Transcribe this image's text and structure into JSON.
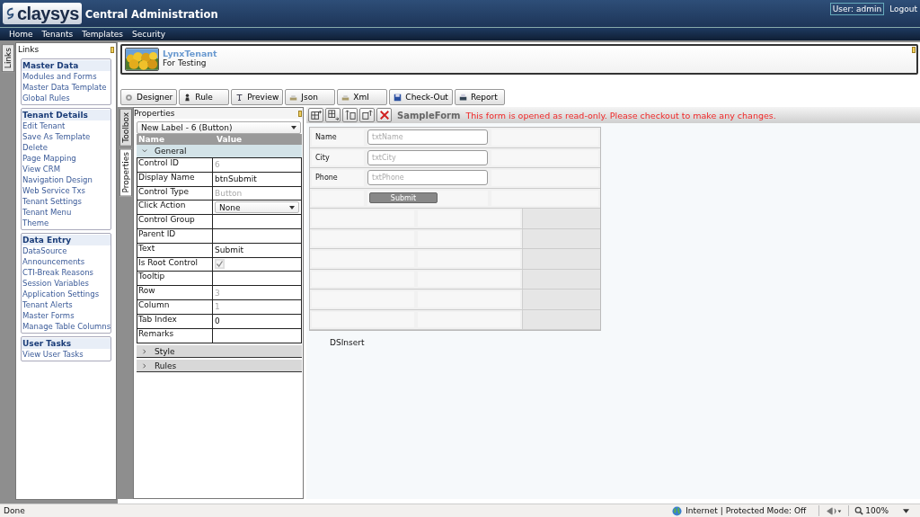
{
  "header": {
    "logo": "claysys",
    "title": "Central Administration",
    "user": "User: admin",
    "logout": "Logout"
  },
  "menu": [
    "Home",
    "Tenants",
    "Templates",
    "Security"
  ],
  "side_tabs": [
    "Links"
  ],
  "links": {
    "title": "Links",
    "groups": [
      {
        "title": "Master Data",
        "items": [
          "Modules and Forms",
          "Master Data Template",
          "Global Rules"
        ]
      },
      {
        "title": "Tenant Details",
        "items": [
          "Edit Tenant",
          "Save As Template",
          "Delete",
          "Page Mapping",
          "View CRM",
          "Navigation Design",
          "Web Service Txs",
          "Tenant Settings",
          "Tenant Menu",
          "Theme"
        ]
      },
      {
        "title": "Data Entry",
        "items": [
          "DataSource",
          "Announcements",
          "CTI-Break Reasons",
          "Session Variables",
          "Application Settings",
          "Tenant Alerts",
          "Master Forms",
          "Manage Table Columns"
        ]
      },
      {
        "title": "User Tasks",
        "items": [
          "View User Tasks"
        ]
      }
    ]
  },
  "tenant": {
    "name": "LynxTenant",
    "description": "For Testing"
  },
  "toolbar": [
    {
      "label": "Designer"
    },
    {
      "label": "Rule"
    },
    {
      "label": "Preview"
    },
    {
      "label": "Json"
    },
    {
      "label": "Xml"
    },
    {
      "label": "Check-Out"
    },
    {
      "label": "Report"
    }
  ],
  "panel_tabs": [
    {
      "label": "Toolbox",
      "selected": false
    },
    {
      "label": "Properties",
      "selected": true
    }
  ],
  "properties": {
    "title": "Properties",
    "selector": "New Label - 6 (Button)",
    "columns": [
      "Name",
      "Value"
    ],
    "sections": [
      {
        "title": "General",
        "expanded": true,
        "rows": [
          {
            "name": "Control ID",
            "kind": "text",
            "value": "6",
            "disabled": true
          },
          {
            "name": "Display Name",
            "kind": "text",
            "value": "btnSubmit",
            "disabled": false
          },
          {
            "name": "Control Type",
            "kind": "text",
            "value": "Button",
            "disabled": true
          },
          {
            "name": "Click Action",
            "kind": "dropdown",
            "value": "None",
            "disabled": false
          },
          {
            "name": "Control Group",
            "kind": "text"
          },
          {
            "name": "Parent ID",
            "kind": "text"
          },
          {
            "name": "Text",
            "kind": "text",
            "value": "Submit",
            "disabled": false
          },
          {
            "name": "Is Root Control",
            "kind": "checkbox",
            "checked": true,
            "disabled": true
          },
          {
            "name": "Tooltip",
            "kind": "text"
          },
          {
            "name": "Row",
            "kind": "text",
            "value": "3",
            "disabled": true
          },
          {
            "name": "Column",
            "kind": "text",
            "value": "1",
            "disabled": true
          },
          {
            "name": "Tab Index",
            "kind": "text",
            "value": "0",
            "disabled": false
          },
          {
            "name": "Remarks",
            "kind": "text"
          }
        ]
      },
      {
        "title": "Style",
        "expanded": false
      },
      {
        "title": "Rules",
        "expanded": false
      }
    ]
  },
  "form_toolbar": {
    "form_name": "SampleForm",
    "message": "This form is opened as read-only. Please checkout to make any changes."
  },
  "form": {
    "rows": [
      {
        "kind": "field",
        "label": "Name",
        "placeholder": "txtName"
      },
      {
        "kind": "field",
        "label": "City",
        "placeholder": "txtCity"
      },
      {
        "kind": "field",
        "label": "Phone",
        "placeholder": "txtPhone"
      },
      {
        "kind": "button",
        "button": "Submit"
      },
      {
        "kind": "empty"
      },
      {
        "kind": "empty"
      },
      {
        "kind": "empty"
      },
      {
        "kind": "empty"
      },
      {
        "kind": "empty"
      },
      {
        "kind": "empty"
      }
    ],
    "footer": "DSInsert"
  },
  "status_bar": {
    "text": "Done",
    "zone": "Internet | Protected Mode: Off",
    "zoom": "100%"
  }
}
